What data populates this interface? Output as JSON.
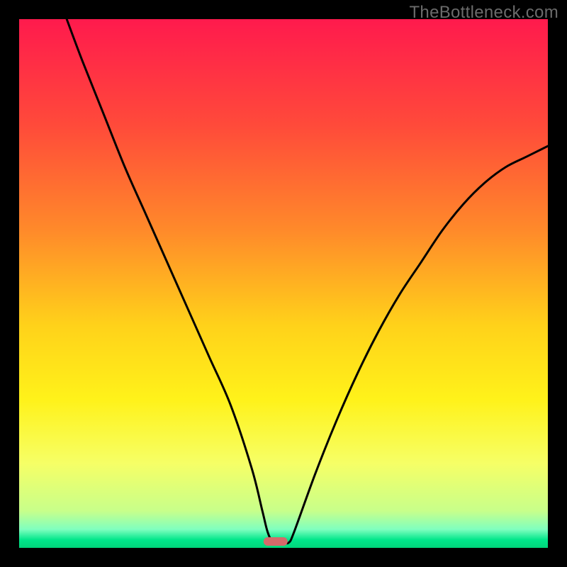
{
  "watermark": "TheBottleneck.com",
  "chart_data": {
    "type": "line",
    "title": "",
    "xlabel": "",
    "ylabel": "",
    "xlim": [
      0,
      100
    ],
    "ylim": [
      0,
      100
    ],
    "grid": false,
    "legend": false,
    "series": [
      {
        "name": "curve",
        "x": [
          9,
          12,
          16,
          20,
          24,
          28,
          32,
          36,
          40,
          44,
          46,
          47,
          48,
          49,
          50,
          51,
          52,
          56,
          60,
          64,
          68,
          72,
          76,
          80,
          84,
          88,
          92,
          96,
          100
        ],
        "values": [
          100,
          92,
          82,
          72,
          63,
          54,
          45,
          36,
          27,
          15,
          7,
          3,
          1,
          1,
          1,
          1,
          3,
          14,
          24,
          33,
          41,
          48,
          54,
          60,
          65,
          69,
          72,
          74,
          76
        ]
      }
    ],
    "marker": {
      "x": 48.5,
      "y": 1.2,
      "shape": "pill",
      "color": "#d46a6a"
    },
    "background_gradient": {
      "direction": "vertical",
      "stops": [
        {
          "pos": 0.0,
          "color": "#ff1a4d"
        },
        {
          "pos": 0.2,
          "color": "#ff4a3a"
        },
        {
          "pos": 0.4,
          "color": "#ff8a2a"
        },
        {
          "pos": 0.58,
          "color": "#ffd21a"
        },
        {
          "pos": 0.72,
          "color": "#fff21a"
        },
        {
          "pos": 0.84,
          "color": "#f6ff66"
        },
        {
          "pos": 0.93,
          "color": "#c8ff8a"
        },
        {
          "pos": 0.965,
          "color": "#7fffbf"
        },
        {
          "pos": 0.985,
          "color": "#00e68a"
        },
        {
          "pos": 1.0,
          "color": "#00d47a"
        }
      ]
    }
  }
}
